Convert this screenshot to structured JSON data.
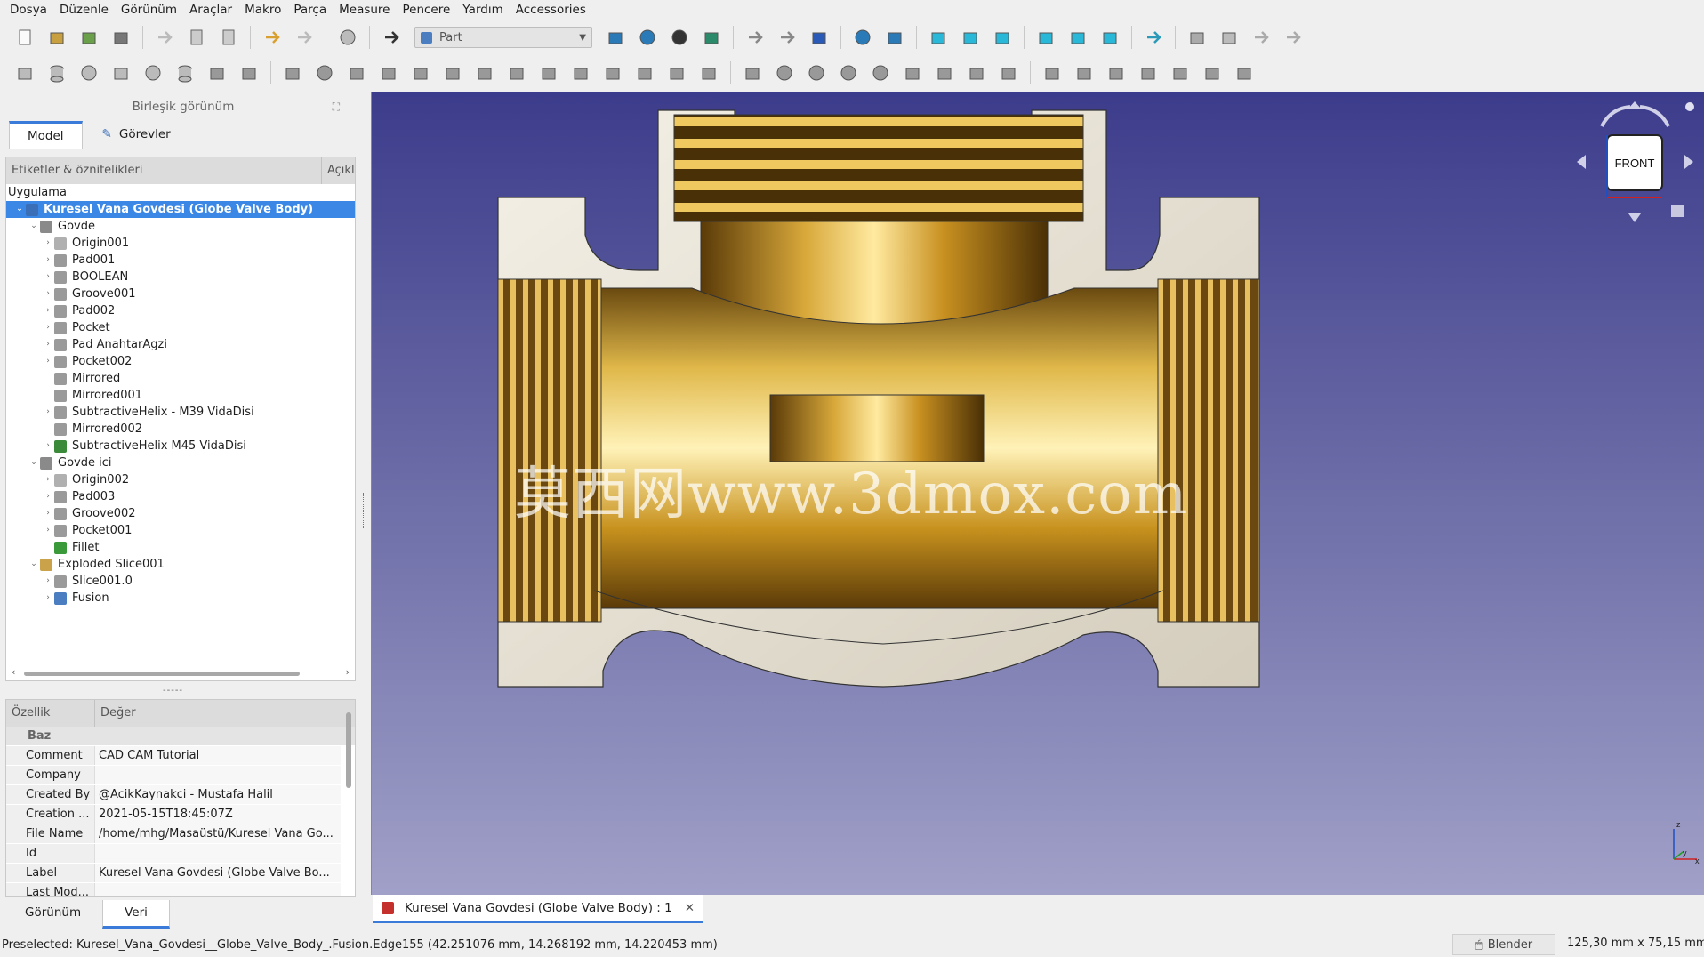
{
  "menu": [
    "Dosya",
    "Düzenle",
    "Görünüm",
    "Araçlar",
    "Makro",
    "Parça",
    "Measure",
    "Pencere",
    "Yardım",
    "Accessories"
  ],
  "workbench": "Part",
  "panel_title": "Birleşik görünüm",
  "tabs_top": [
    "Model",
    "Görevler"
  ],
  "tree": {
    "col1": "Etiketler & öznitelikleri",
    "col2": "Açıkl",
    "app_label": "Uygulama",
    "rows": [
      {
        "label": "Kuresel Vana Govdesi (Globe Valve Body)",
        "depth": 0,
        "arrow": "v",
        "icon": "#3a6fb8",
        "selected": true
      },
      {
        "label": "Govde",
        "depth": 1,
        "arrow": "v",
        "icon": "#8a8a8a"
      },
      {
        "label": "Origin001",
        "depth": 2,
        "arrow": ">",
        "icon": "#b0b0b0"
      },
      {
        "label": "Pad001",
        "depth": 2,
        "arrow": ">",
        "icon": "#9a9a9a"
      },
      {
        "label": "BOOLEAN",
        "depth": 2,
        "arrow": ">",
        "icon": "#9a9a9a"
      },
      {
        "label": "Groove001",
        "depth": 2,
        "arrow": ">",
        "icon": "#9a9a9a"
      },
      {
        "label": "Pad002",
        "depth": 2,
        "arrow": ">",
        "icon": "#9a9a9a"
      },
      {
        "label": "Pocket",
        "depth": 2,
        "arrow": ">",
        "icon": "#9a9a9a"
      },
      {
        "label": "Pad AnahtarAgzi",
        "depth": 2,
        "arrow": ">",
        "icon": "#9a9a9a"
      },
      {
        "label": "Pocket002",
        "depth": 2,
        "arrow": ">",
        "icon": "#9a9a9a"
      },
      {
        "label": "Mirrored",
        "depth": 2,
        "arrow": "",
        "icon": "#9a9a9a"
      },
      {
        "label": "Mirrored001",
        "depth": 2,
        "arrow": "",
        "icon": "#9a9a9a"
      },
      {
        "label": "SubtractiveHelix - M39 VidaDisi",
        "depth": 2,
        "arrow": ">",
        "icon": "#9a9a9a"
      },
      {
        "label": "Mirrored002",
        "depth": 2,
        "arrow": "",
        "icon": "#9a9a9a"
      },
      {
        "label": "SubtractiveHelix M45 VidaDisi",
        "depth": 2,
        "arrow": ">",
        "icon": "#3a8a3a"
      },
      {
        "label": "Govde ici",
        "depth": 1,
        "arrow": "v",
        "icon": "#8a8a8a"
      },
      {
        "label": "Origin002",
        "depth": 2,
        "arrow": ">",
        "icon": "#b0b0b0"
      },
      {
        "label": "Pad003",
        "depth": 2,
        "arrow": ">",
        "icon": "#9a9a9a"
      },
      {
        "label": "Groove002",
        "depth": 2,
        "arrow": ">",
        "icon": "#9a9a9a"
      },
      {
        "label": "Pocket001",
        "depth": 2,
        "arrow": ">",
        "icon": "#9a9a9a"
      },
      {
        "label": "Fillet",
        "depth": 2,
        "arrow": "",
        "icon": "#3a9a3a"
      },
      {
        "label": "Exploded Slice001",
        "depth": 1,
        "arrow": "v",
        "icon": "#c9a24a"
      },
      {
        "label": "Slice001.0",
        "depth": 2,
        "arrow": ">",
        "icon": "#9a9a9a"
      },
      {
        "label": "Fusion",
        "depth": 2,
        "arrow": ">",
        "icon": "#4a7ec0"
      }
    ]
  },
  "props": {
    "col1": "Özellik",
    "col2": "Değer",
    "group": "Baz",
    "rows": [
      {
        "k": "Comment",
        "v": "CAD CAM Tutorial"
      },
      {
        "k": "Company",
        "v": ""
      },
      {
        "k": "Created By",
        "v": "@AcikKaynakci - Mustafa Halil"
      },
      {
        "k": "Creation ...",
        "v": "2021-05-15T18:45:07Z"
      },
      {
        "k": "File Name",
        "v": "/home/mhg/Masaüstü/Kuresel Vana Go..."
      },
      {
        "k": "Id",
        "v": ""
      },
      {
        "k": "Label",
        "v": "Kuresel Vana Govdesi (Globe Valve Bo..."
      },
      {
        "k": "Last Mod...",
        "v": ""
      }
    ]
  },
  "tabs_bottom": [
    "Görünüm",
    "Veri"
  ],
  "doc_tab": "Kuresel Vana Govdesi (Globe Valve Body) : 1",
  "status": "Preselected: Kuresel_Vana_Govdesi__Globe_Valve_Body_.Fusion.Edge155 (42.251076 mm, 14.268192 mm, 14.220453 mm)",
  "nav_style": "Blender",
  "dims": "125,30 mm x 75,15 mm",
  "navcube_face": "FRONT",
  "watermark": "莫西网www.3dmox.com",
  "axis": {
    "z": "z",
    "y": "y",
    "x": "x"
  }
}
